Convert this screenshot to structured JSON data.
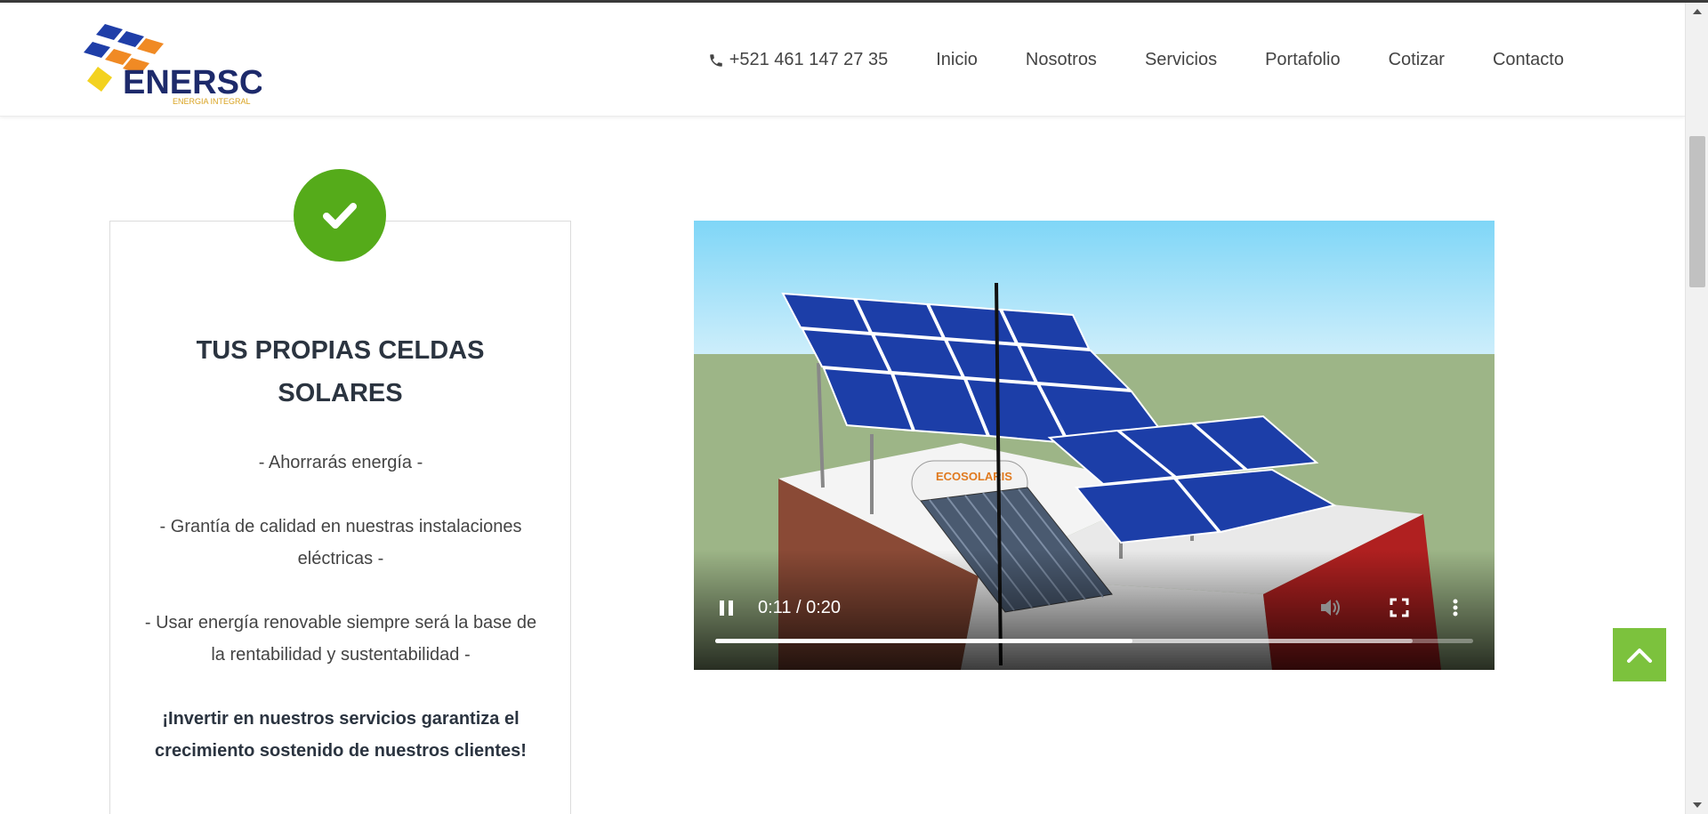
{
  "brand": {
    "logo_text": "ENERSCI",
    "logo_tagline": "ENERGIA INTEGRAL",
    "colors": {
      "blue": "#1f3ea8",
      "orange": "#f08a24",
      "yellow": "#f3d21f",
      "navy": "#1d2a6b"
    }
  },
  "nav": {
    "phone": "+521 461 147 27 35",
    "items": [
      "Inicio",
      "Nosotros",
      "Servicios",
      "Portafolio",
      "Cotizar",
      "Contacto"
    ]
  },
  "card": {
    "icon": "checkmark-icon",
    "title_line1": "TUS PROPIAS CELDAS",
    "title_line2": "SOLARES",
    "line1": "- Ahorrarás energía -",
    "line2a": "- Grantía de calidad en nuestras instalaciones",
    "line2b": "eléctricas -",
    "line3a": "- Usar energía renovable siempre será la base de",
    "line3b": "la rentabilidad y sustentabilidad -",
    "strong_a": "¡Invertir en nuestros servicios garantiza el",
    "strong_b": "crecimiento sostenido de nuestros clientes!",
    "accent_color": "#55ab1a"
  },
  "video": {
    "time": "0:11 / 0:20",
    "progress": 0.55,
    "buffered": 0.92,
    "tank_label": "ECOSOLARIS",
    "controls": [
      "pause-icon",
      "volume-icon",
      "fullscreen-icon",
      "more-options-icon"
    ]
  },
  "back_to_top": {
    "icon": "chevron-up-icon",
    "color": "#7cc23d"
  }
}
